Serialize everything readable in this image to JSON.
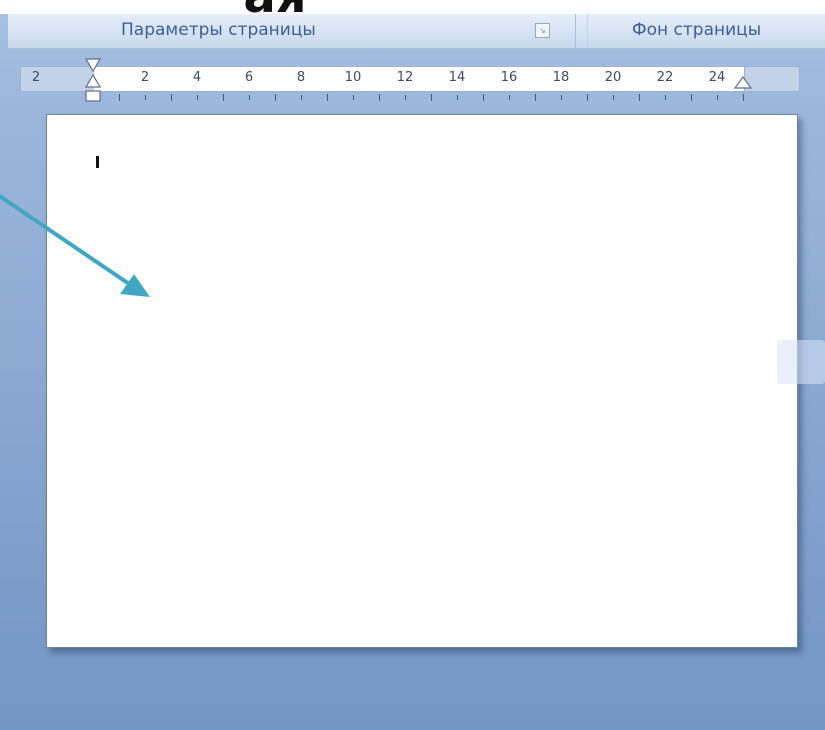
{
  "slide": {
    "title_fragment": "ая"
  },
  "ribbon": {
    "page_setup_group": "Параметры страницы",
    "page_background_group": "Фон страницы",
    "launcher_icon": "dialog-launcher-icon"
  },
  "ruler": {
    "left_label": "2",
    "numbers": [
      "2",
      "4",
      "6",
      "8",
      "10",
      "12",
      "14",
      "16",
      "18",
      "20",
      "22",
      "24"
    ],
    "units": "cm"
  },
  "document": {
    "text": ""
  },
  "colors": {
    "ribbon_text": "#3c5f99",
    "arrow": "#3fa7c4",
    "background": "#8eabd3"
  }
}
